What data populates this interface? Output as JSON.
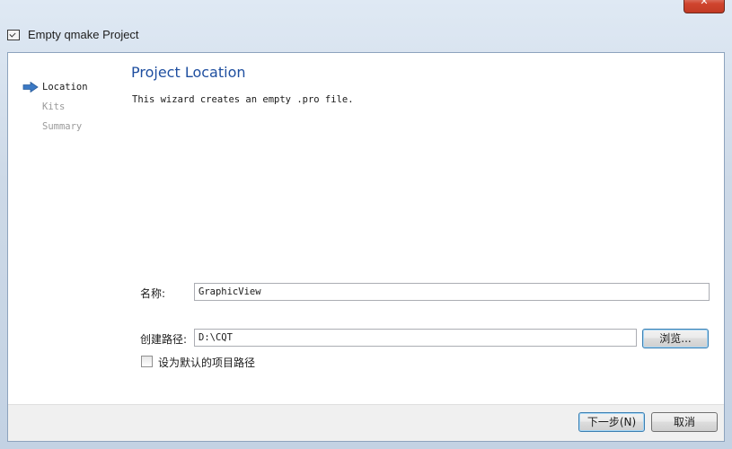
{
  "window": {
    "title": "Empty qmake Project",
    "close_glyph": "✕"
  },
  "sidebar": {
    "items": [
      {
        "label": "Location",
        "active": true
      },
      {
        "label": "Kits",
        "active": false
      },
      {
        "label": "Summary",
        "active": false
      }
    ]
  },
  "page": {
    "title": "Project Location",
    "description": "This wizard creates an empty .pro file."
  },
  "form": {
    "name_label": "名称:",
    "name_value": "GraphicView",
    "path_label": "创建路径:",
    "path_value": "D:\\CQT",
    "browse_label": "浏览...",
    "default_checkbox_label": "设为默认的项目路径",
    "default_checkbox_checked": false
  },
  "footer": {
    "next_label": "下一步(N)",
    "cancel_label": "取消"
  },
  "colors": {
    "title_blue": "#1f4fa0",
    "arrow_blue": "#3b79c4"
  },
  "icons": {
    "window": "wizard-window-icon",
    "step_marker": "arrow-right-icon"
  }
}
